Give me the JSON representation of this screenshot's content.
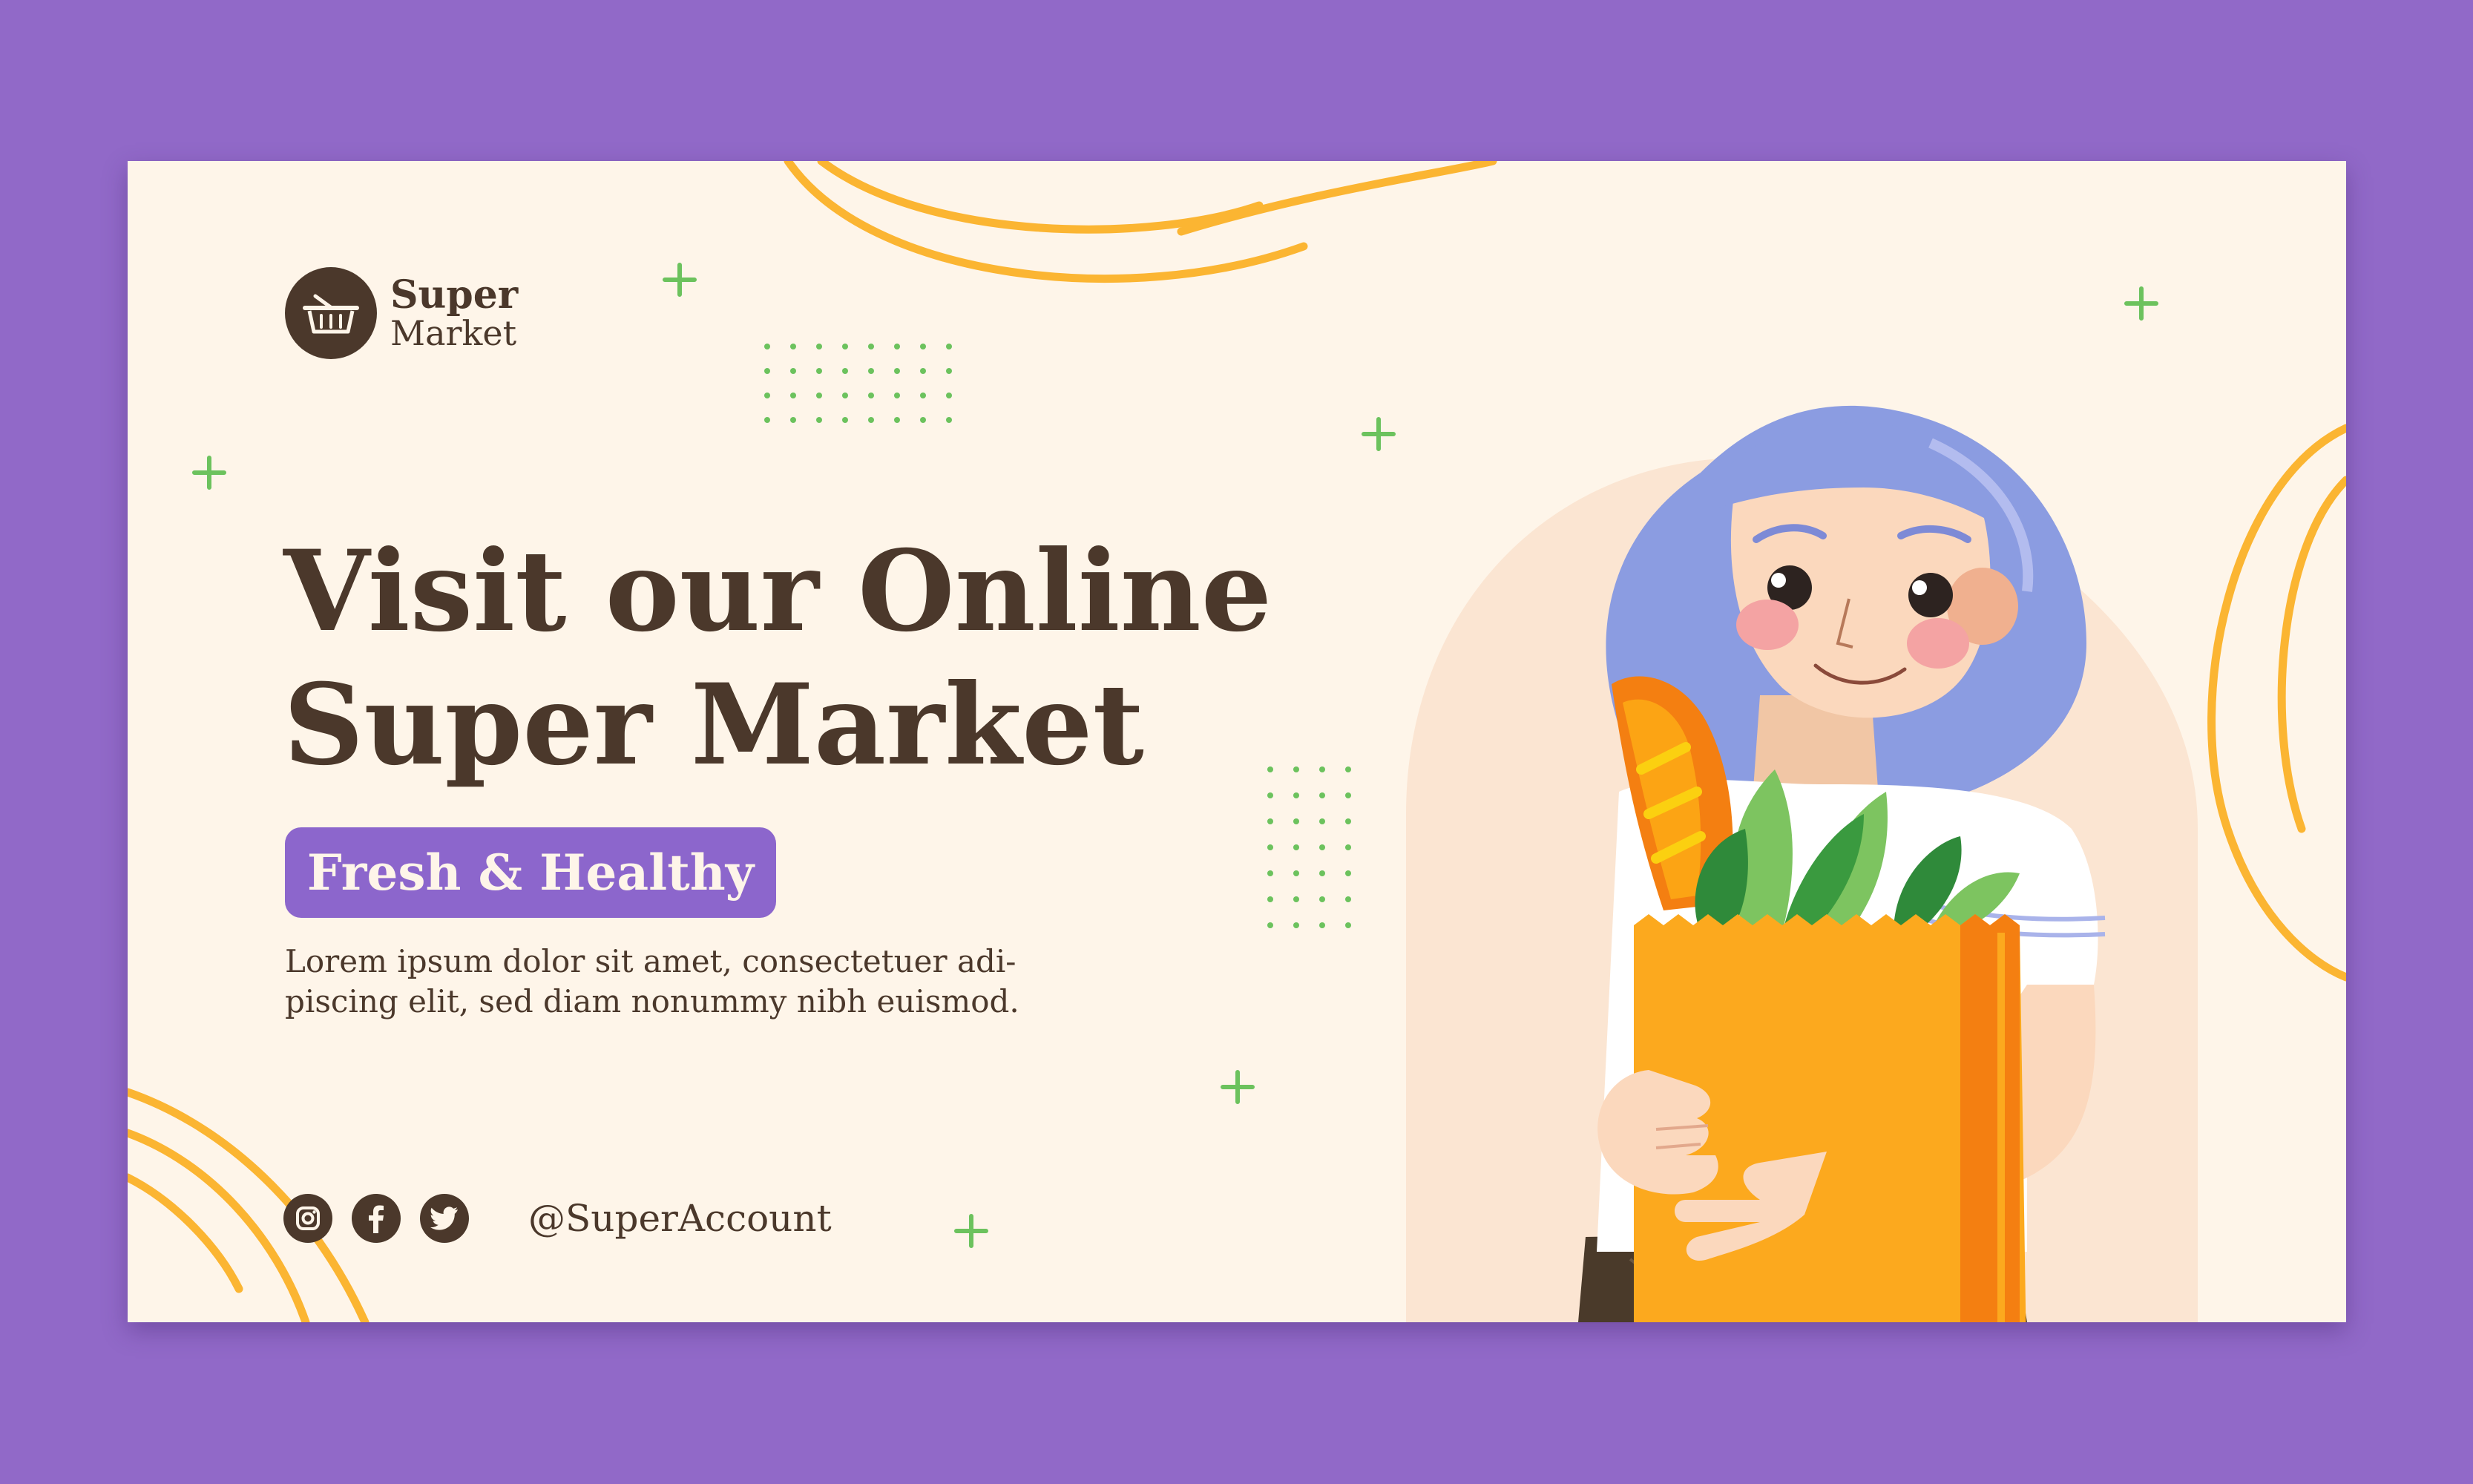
{
  "brand": {
    "name_line1": "Super",
    "name_line2": "Market",
    "icon": "shopping-basket-icon"
  },
  "headline": {
    "line1": "Visit our Online",
    "line2": "Super Market"
  },
  "badge": {
    "label": "Fresh & Healthy"
  },
  "body": {
    "line1": "Lorem ipsum dolor sit amet, consectetuer adi-",
    "line2": "piscing elit, sed diam nonummy nibh euismod."
  },
  "social": {
    "icons": [
      "instagram-icon",
      "facebook-icon",
      "twitter-icon"
    ],
    "handle": "@SuperAccount"
  },
  "colors": {
    "page_background": "#9169c8",
    "card_background": "#fef5e9",
    "text": "#4b382b",
    "accent_purple": "#8c66cc",
    "accent_yellow": "#fbb532",
    "accent_green": "#6cc25d"
  }
}
